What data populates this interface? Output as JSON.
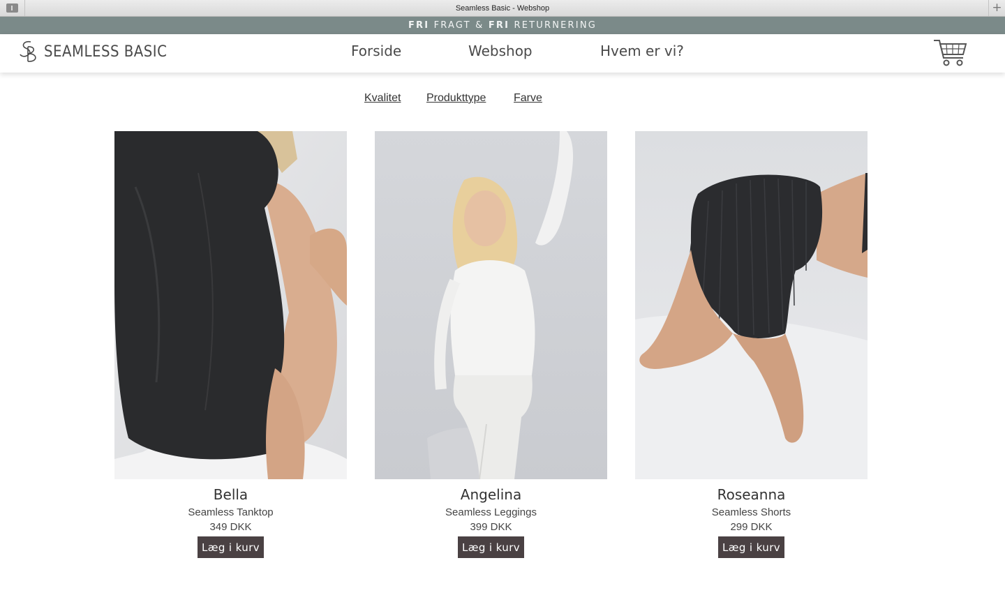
{
  "browser": {
    "title": "Seamless Basic - Webshop"
  },
  "promo": {
    "word1": "FRI",
    "text1": " FRAGT & ",
    "word2": "FRI",
    "text2": " RETURNERING"
  },
  "header": {
    "logo_text": "SEAMLESS BASIC",
    "nav": {
      "home": "Forside",
      "shop": "Webshop",
      "about": "Hvem er vi?"
    }
  },
  "filters": {
    "quality": "Kvalitet",
    "product_type": "Produkttype",
    "color": "Farve"
  },
  "products": [
    {
      "name": "Bella",
      "type": "Seamless Tanktop",
      "price": "349 DKK",
      "button": "Læg i kurv"
    },
    {
      "name": "Angelina",
      "type": "Seamless Leggings",
      "price": "399 DKK",
      "button": "Læg i kurv"
    },
    {
      "name": "Roseanna",
      "type": "Seamless Shorts",
      "price": "299 DKK",
      "button": "Læg i kurv"
    }
  ],
  "colors": {
    "promo_bar": "#7b8a89",
    "button": "#4a4143"
  }
}
